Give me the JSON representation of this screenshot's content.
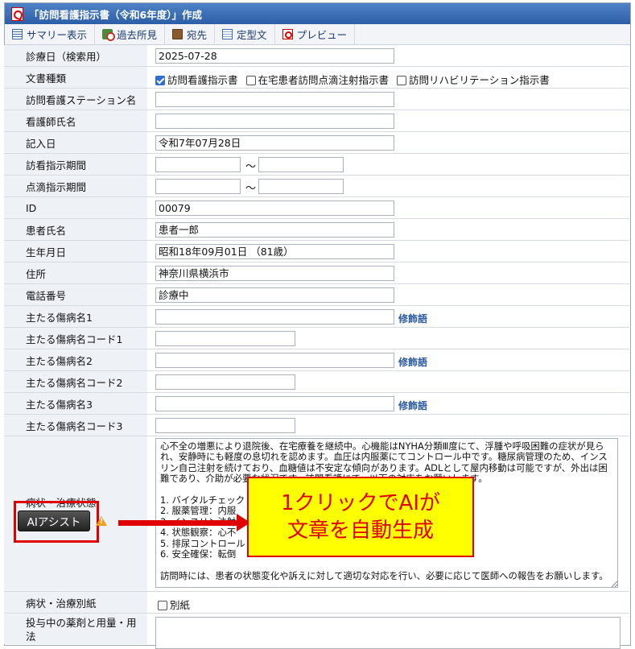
{
  "window": {
    "title": "「訪問看護指示書（令和6年度）」作成"
  },
  "toolbar": {
    "summary": "サマリー表示",
    "history": "過去所見",
    "address": "宛先",
    "template": "定型文",
    "preview": "プレビュー"
  },
  "form": {
    "exam_date_label": "診療日（検索用）",
    "exam_date_value": "2025-07-28",
    "doc_type_label": "文書種類",
    "doc_types": [
      {
        "label": "訪問看護指示書",
        "checked": true
      },
      {
        "label": "在宅患者訪問点滴注射指示書",
        "checked": false
      },
      {
        "label": "訪問リハビリテーション指示書",
        "checked": false
      }
    ],
    "station_label": "訪問看護ステーション名",
    "station_value": "",
    "nurse_label": "看護師氏名",
    "nurse_value": "",
    "entry_date_label": "記入日",
    "entry_date_value": "令和7年07月28日",
    "visit_period_label": "訪看指示期間",
    "drip_period_label": "点滴指示期間",
    "tilde": "～",
    "id_label": "ID",
    "id_value": "00079",
    "patient_name_label": "患者氏名",
    "patient_name_value": "患者一郎",
    "birth_label": "生年月日",
    "birth_value": "昭和18年09月01日 （81歳）",
    "address_label": "住所",
    "address_value": "神奈川県横浜市",
    "phone_label": "電話番号",
    "phone_value": "診療中",
    "disease1_label": "主たる傷病名1",
    "disease_code1_label": "主たる傷病名コード1",
    "disease2_label": "主たる傷病名2",
    "disease_code2_label": "主たる傷病名コード2",
    "disease3_label": "主たる傷病名3",
    "disease_code3_label": "主たる傷病名コード3",
    "modifier_link": "修飾語",
    "condition_label": "病状・治療状態",
    "condition_text": "心不全の増悪により退院後、在宅療養を継続中。心機能はNYHA分類Ⅲ度にて、浮腫や呼吸困難の症状が見られ、安静時にも軽度の息切れを認めます。血圧は内服薬にてコントロール中です。糖尿病管理のため、インスリン自己注射を続けており、血糖値は不安定な傾向があります。ADLとして屋内移動は可能ですが、外出は困難であり、介助が必要な状況です。訪問看護にて、以下の対応をお願いします。\n\n1. バイタルチェック\n2. 服薬管理：内服\n3. インスリン注射\n4. 状態観察：心不\n5. 排尿コントロール\n6. 安全確保：転倒\n\n訪問時には、患者の状態変化や訴えに対して適切な対応を行い、必要に応じて医師への報告をお願いします。",
    "ai_button": "AIアシスト",
    "warn_mark": "!",
    "separate_label": "病状・治療別紙",
    "separate_checkbox": "別紙",
    "medication_label": "投与中の薬剤と用量・用法"
  },
  "callout": {
    "line1": "1クリックでAIが",
    "line2": "文章を自動生成"
  }
}
